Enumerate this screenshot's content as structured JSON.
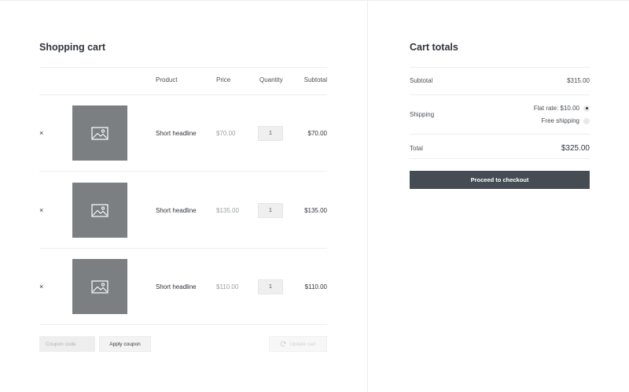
{
  "cart": {
    "title": "Shopping cart",
    "columns": {
      "product": "Product",
      "price": "Price",
      "quantity": "Quantity",
      "subtotal": "Subtotal"
    },
    "items": [
      {
        "remove": "×",
        "name": "Short headline",
        "price": "$70.00",
        "quantity": "1",
        "subtotal": "$70.00"
      },
      {
        "remove": "×",
        "name": "Short headline",
        "price": "$135.00",
        "quantity": "1",
        "subtotal": "$135.00"
      },
      {
        "remove": "×",
        "name": "Short headline",
        "price": "$110.00",
        "quantity": "1",
        "subtotal": "$110.00"
      }
    ],
    "coupon_placeholder": "Coupon code",
    "apply_coupon_label": "Apply coupon",
    "update_cart_label": "Update cart"
  },
  "totals": {
    "title": "Cart totals",
    "subtotal_label": "Subtotal",
    "subtotal_value": "$315.00",
    "shipping_label": "Shipping",
    "shipping_options": [
      {
        "label": "Flat rate: $10.00",
        "selected": true
      },
      {
        "label": "Free shipping",
        "selected": false
      }
    ],
    "total_label": "Total",
    "total_value": "$325.00",
    "checkout_label": "Proceed to checkout"
  },
  "colors": {
    "thumbnail": "#7b7f82",
    "checkout_button": "#464c53",
    "divider": "#eeeeee"
  },
  "icons": {
    "thumbnail": "image-placeholder-icon",
    "update": "refresh-icon",
    "remove": "close-icon"
  }
}
